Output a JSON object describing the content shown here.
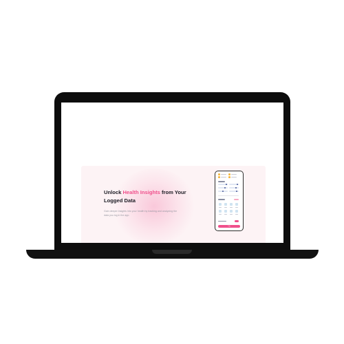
{
  "hero": {
    "title_prefix": "Unlock ",
    "title_accent": "Health Insights",
    "title_suffix": " from Your Logged Data",
    "description": "Gain deeper insights into your health by tracking and analyzing the data you log in the app.",
    "accent_color": "#f0508c"
  },
  "device": {
    "type": "laptop",
    "phone_preview": {
      "cta_label": "Log"
    }
  }
}
